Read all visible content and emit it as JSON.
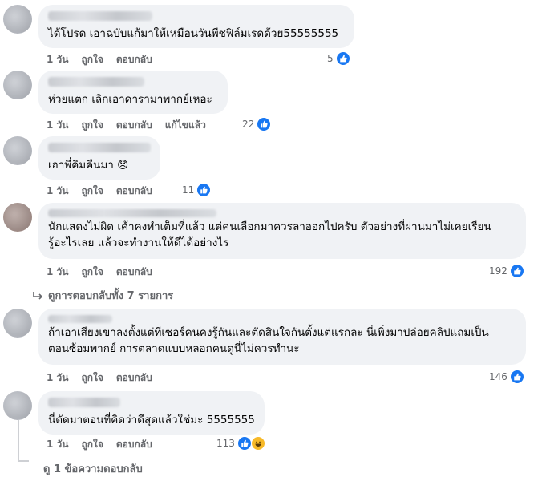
{
  "comments": [
    {
      "text": "ได้โปรด เอาฉบับแก้มาให้เหมือนวันพีชฟิล์มเรดด้วย55555555",
      "time": "1 วัน",
      "like": "ถูกใจ",
      "reply": "ตอบกลับ",
      "edited": "",
      "count": "5"
    },
    {
      "text": "ห่วยแตก เลิกเอาดารามาพากย์เหอะ",
      "time": "1 วัน",
      "like": "ถูกใจ",
      "reply": "ตอบกลับ",
      "edited": "แก้ไขแล้ว",
      "count": "22"
    },
    {
      "text": "เอาพี่คิมคืนมา 😞",
      "time": "1 วัน",
      "like": "ถูกใจ",
      "reply": "ตอบกลับ",
      "edited": "",
      "count": "11"
    },
    {
      "text": "นักแสดงไม่ผิด เค้าคงทำเต็มที่แล้ว แต่คนเลือกมาควรลาออกไปครับ ตัวอย่างที่ผ่านมาไม่เคยเรียน\nรู้อะไรเลย แล้วจะทำงานให้ดีได้อย่างไร",
      "time": "1 วัน",
      "like": "ถูกใจ",
      "reply": "ตอบกลับ",
      "edited": "",
      "count": "192"
    },
    {
      "text": "ถ้าเอาเสียงเขาลงตั้งแต่ทีเซอร์คนคงรู้กันและตัดสินใจกันตั้งแต่แรกละ นี่เพิ่งมาปล่อยคลิปแถมเป็น\nตอนซ้อมพากย์ การตลาดแบบหลอกคนดูนี่ไม่ควรทำนะ",
      "time": "1 วัน",
      "like": "ถูกใจ",
      "reply": "ตอบกลับ",
      "edited": "",
      "count": "146"
    },
    {
      "text": "นี่ตัดมาตอนที่คิดว่าดีสุดแล้วใช่มะ 5555555",
      "time": "1 วัน",
      "like": "ถูกใจ",
      "reply": "ตอบกลับ",
      "edited": "",
      "count": "113"
    }
  ],
  "view_replies_1": "ดูการตอบกลับทั้ง 7 รายการ",
  "view_replies_2": "ดู 1 ข้อความตอบกลับ",
  "icons": {
    "like": "like-reaction-icon",
    "laugh": "haha-reaction-icon",
    "reply_arrow": "reply-arrow-icon"
  },
  "colors": {
    "bubble": "#f0f2f5",
    "like_blue": "#1877f2",
    "meta_gray": "#65676b"
  }
}
